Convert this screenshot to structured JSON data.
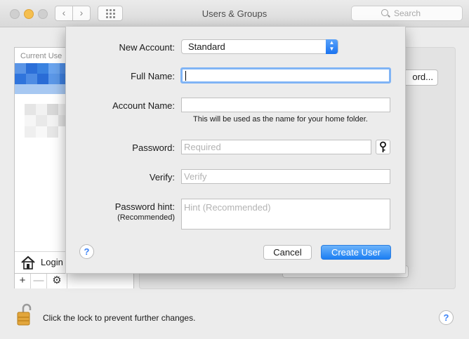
{
  "window": {
    "title": "Users & Groups"
  },
  "toolbar": {
    "back_icon": "‹",
    "forward_icon": "›",
    "search_placeholder": "Search"
  },
  "sidebar": {
    "current_users_label": "Current Use",
    "login_options_label": "Login",
    "add_label": "+",
    "remove_label": "—",
    "gear_label": "⚙"
  },
  "main": {
    "password_button_label": "ord..."
  },
  "footer": {
    "lock_text": "Click the lock to prevent further changes.",
    "help_label": "?"
  },
  "sheet": {
    "new_account_label": "New Account:",
    "new_account_value": "Standard",
    "full_name_label": "Full Name:",
    "full_name_value": "",
    "account_name_label": "Account Name:",
    "account_name_value": "",
    "account_name_note": "This will be used as the name for your home folder.",
    "password_label": "Password:",
    "password_placeholder": "Required",
    "verify_label": "Verify:",
    "verify_placeholder": "Verify",
    "hint_label": "Password hint:",
    "hint_sublabel": "(Recommended)",
    "hint_placeholder": "Hint (Recommended)",
    "help_label": "?",
    "cancel_label": "Cancel",
    "create_label": "Create User"
  },
  "colors": {
    "accent": "#1b7ef3",
    "focus_ring": "#80b4f5",
    "avatar_blue": "#3a82e0"
  }
}
